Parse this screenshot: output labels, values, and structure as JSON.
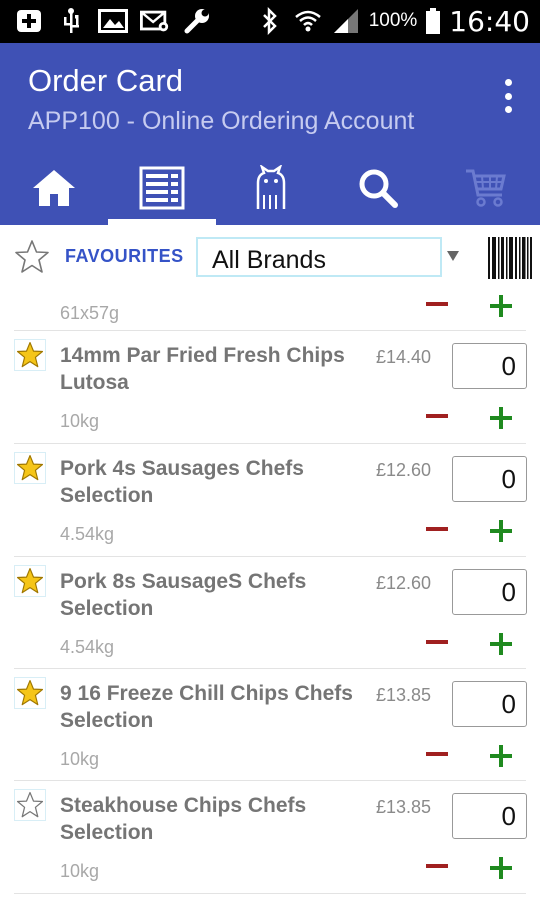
{
  "status_bar": {
    "battery_percent": "100%",
    "time": "16:40",
    "icons": [
      "add-box-icon",
      "usb-icon",
      "image-icon",
      "mail-settings-icon",
      "wrench-icon",
      "bluetooth-icon",
      "wifi-icon",
      "signal-icon",
      "battery-icon"
    ]
  },
  "app_bar": {
    "title": "Order Card",
    "subtitle": "APP100 - Online Ordering Account",
    "overflow_icon": "overflow-menu-icon",
    "tabs": [
      {
        "icon": "home-icon",
        "active": false
      },
      {
        "icon": "order-list-icon",
        "active": true
      },
      {
        "icon": "cat-icon",
        "active": false
      },
      {
        "icon": "search-icon",
        "active": false
      },
      {
        "icon": "cart-icon",
        "active": false,
        "disabled": true
      }
    ],
    "color": "#3f51b5"
  },
  "filter": {
    "favourites_label": "FAVOURITES",
    "brand_selected": "All Brands",
    "barcode_icon": "barcode-icon"
  },
  "list": {
    "top_partial_weight": "61x57g",
    "items": [
      {
        "name": "14mm Par Fried Fresh Chips Lutosa",
        "price": "£14.40",
        "qty": "0",
        "weight": "10kg",
        "favourite": true
      },
      {
        "name": "Pork 4s Sausages Chefs Selection",
        "price": "£12.60",
        "qty": "0",
        "weight": "4.54kg",
        "favourite": true
      },
      {
        "name": "Pork 8s SausageS Chefs Selection",
        "price": "£12.60",
        "qty": "0",
        "weight": "4.54kg",
        "favourite": true
      },
      {
        "name": "9 16 Freeze Chill Chips Chefs Selection",
        "price": "£13.85",
        "qty": "0",
        "weight": "10kg",
        "favourite": true
      },
      {
        "name": "Steakhouse Chips Chefs Selection",
        "price": "£13.85",
        "qty": "0",
        "weight": "10kg",
        "favourite": false
      }
    ]
  },
  "colors": {
    "minus": "#a02020",
    "plus": "#1f8a1f",
    "star_filled": "#f5c518",
    "favourites_label": "#3553c7"
  }
}
